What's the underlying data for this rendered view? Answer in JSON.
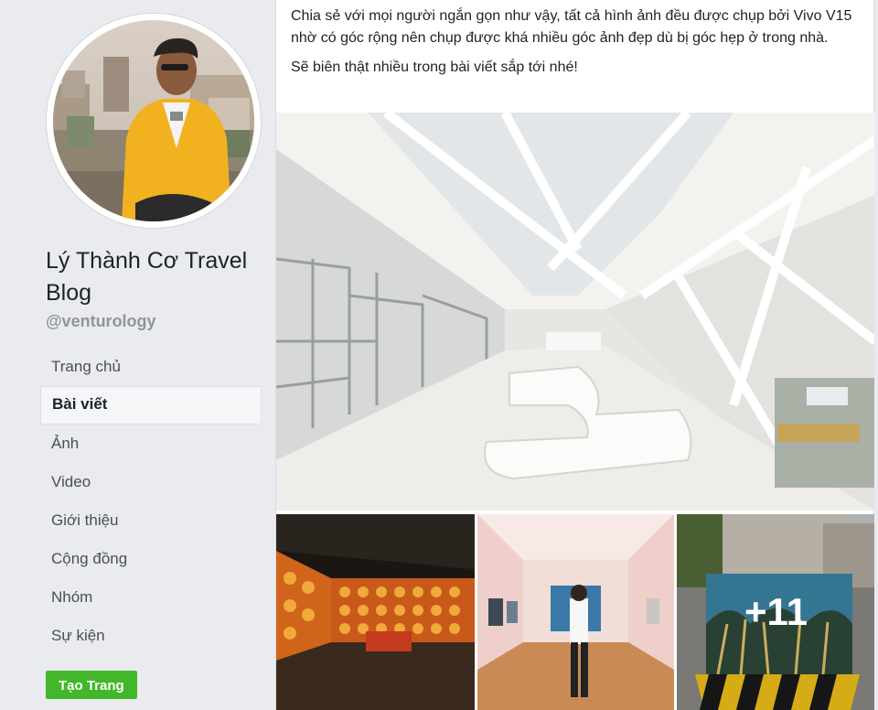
{
  "profile": {
    "name": "Lý Thành Cơ Travel Blog",
    "handle": "@venturology"
  },
  "nav": {
    "items": [
      {
        "label": "Trang chủ",
        "active": false
      },
      {
        "label": "Bài viết",
        "active": true
      },
      {
        "label": "Ảnh",
        "active": false
      },
      {
        "label": "Video",
        "active": false
      },
      {
        "label": "Giới thiệu",
        "active": false
      },
      {
        "label": "Cộng đồng",
        "active": false
      },
      {
        "label": "Nhóm",
        "active": false
      },
      {
        "label": "Sự kiện",
        "active": false
      }
    ],
    "create_page_label": "Tạo Trang"
  },
  "post": {
    "paragraph_1": "Chia sẻ với mọi người ngắn gọn như vậy, tất cả hình ảnh đều được chụp bởi Vivo V15 nhờ có góc rộng nên chụp được khá nhiều góc ảnh đẹp dù bị góc hẹp ở trong nhà.",
    "paragraph_2": "Sẽ biên thật nhiều trong bài viết sắp tới nhé!",
    "more_photos_label": "+11"
  },
  "colors": {
    "sidebar_bg": "#e9ebee",
    "create_button": "#42b72a",
    "handle_text": "#90949c"
  }
}
